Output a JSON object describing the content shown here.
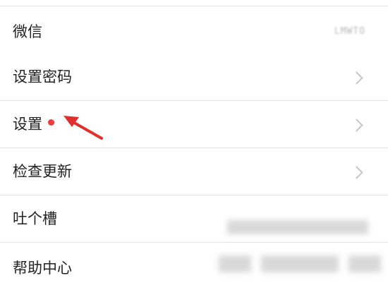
{
  "settings": {
    "items": [
      {
        "label": "微信",
        "value": "LMWTO"
      },
      {
        "label": "设置密码"
      },
      {
        "label": "设置"
      },
      {
        "label": "检查更新"
      },
      {
        "label": "吐个槽"
      },
      {
        "label": "帮助中心"
      }
    ]
  },
  "colors": {
    "badge": "#ee3b3b",
    "annotation_arrow": "#e0302b",
    "chevron": "#c6c6c8"
  },
  "icons": {
    "chevron": "chevron-right-icon",
    "badge": "red-dot-badge",
    "annotation": "red-arrow-annotation"
  }
}
